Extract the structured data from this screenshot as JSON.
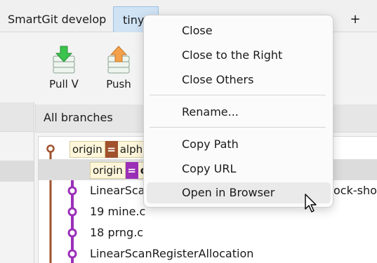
{
  "tabs": [
    {
      "label": "SmartGit develop"
    },
    {
      "label": "tiny"
    }
  ],
  "tab_add_label": "+",
  "toolbar": {
    "pull_label": "Pull ᐯ",
    "push_label": "Push"
  },
  "branches_header": "All branches",
  "graph_rows": [
    {
      "ref_origin": "origin",
      "ref_tail": "alpha"
    },
    {
      "ref_origin": "origin",
      "ref_tail": "c"
    },
    {
      "text": "LinearScan",
      "text_right": "ock-shou"
    },
    {
      "text": "19 mine.c"
    },
    {
      "text": "18 prng.c"
    },
    {
      "text": "LinearScanRegisterAllocation"
    }
  ],
  "ref_equal_symbol": "=",
  "context_menu": {
    "items": [
      {
        "label": "Close"
      },
      {
        "label": "Close to the Right"
      },
      {
        "label": "Close Others"
      },
      {
        "label": "Rename..."
      },
      {
        "label": "Copy Path"
      },
      {
        "label": "Copy URL"
      },
      {
        "label": "Open in Browser"
      }
    ],
    "hovered_item": "Open in Browser"
  },
  "colors": {
    "accent_brown": "#a0522d",
    "accent_purple": "#9b2fb8",
    "selected_tab": "#cfe3f5",
    "ref_bg": "#fdf6da"
  },
  "icons": {
    "pull": "pull-arrow-down-icon",
    "push": "push-arrow-up-icon",
    "cursor": "mouse-pointer-icon"
  }
}
